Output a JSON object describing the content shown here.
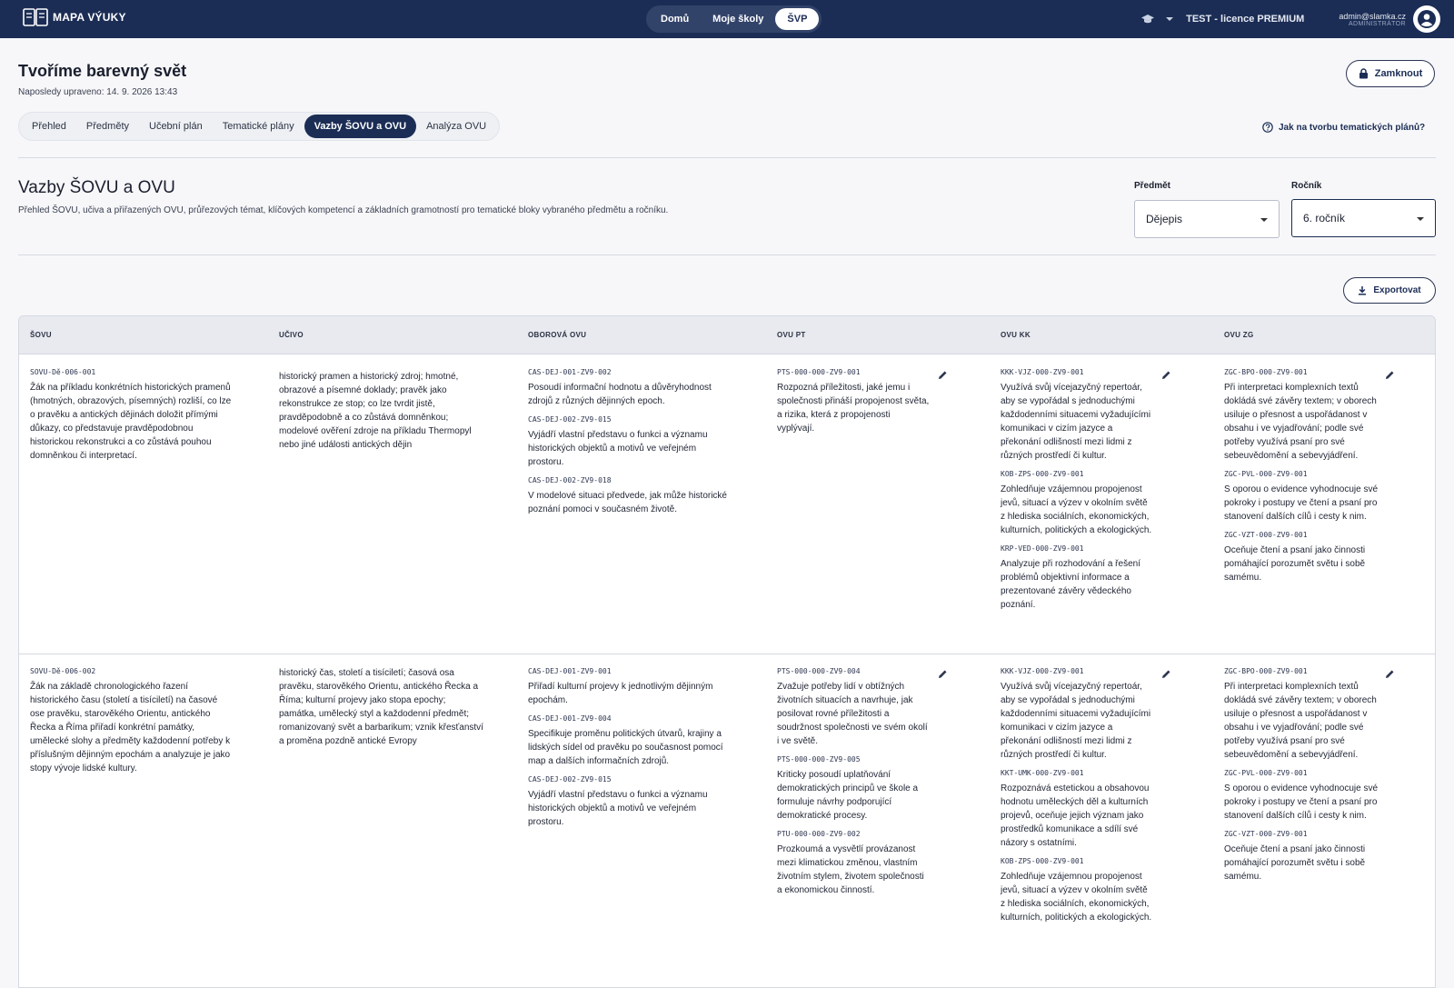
{
  "app": {
    "brand": "MAPA VÝUKY",
    "nav": [
      "Domů",
      "Moje školy",
      "ŠVP"
    ],
    "nav_active": 2,
    "license": "TEST - licence PREMIUM",
    "user_email": "admin@slamka.cz",
    "user_role": "ADMINISTRÁTOR",
    "accent_color": "#1b2d55"
  },
  "header": {
    "title": "Tvoříme barevný svět",
    "last_edited": "Naposledy upraveno: 14. 9. 2026 13:43",
    "lock_label": "Zamknout",
    "tabs": [
      "Přehled",
      "Předměty",
      "Učební plán",
      "Tematické plány",
      "Vazby ŠOVU a OVU",
      "Analýza OVU"
    ],
    "active_tab": 4,
    "help_link": "Jak na tvorbu tematických plánů?"
  },
  "section": {
    "title": "Vazby ŠOVU a OVU",
    "description": "Přehled ŠOVU, učiva a přiřazených OVU, průřezových témat, klíčových kompetencí a základních gramotností pro tematické bloky vybraného předmětu a ročníku.",
    "subject_label": "Předmět",
    "subject_value": "Dějepis",
    "grade_label": "Ročník",
    "grade_value": "6. ročník",
    "export_label": "Exportovat"
  },
  "table": {
    "headers": [
      "ŠOVU",
      "UČIVO",
      "OBOROVÁ OVU",
      "OVU PT",
      "OVU KK",
      "OVU ZG"
    ],
    "rows": [
      {
        "sovu_code": "SOVU-Dě-006-001",
        "sovu_text": "Žák na příkladu konkrétních historických pramenů (hmotných, obrazových, písemných) rozliší, co lze o pravěku a antických dějinách doložit přímými důkazy, co představuje pravděpodobnou historickou rekonstrukci a co zůstává pouhou domněnkou či interpretací.",
        "ucivo": "historický pramen a historický zdroj; hmotné, obrazové a písemné doklady; pravěk jako rekonstrukce ze stop; co lze tvrdit jistě, pravděpodobně a co zůstává domněnkou; modelové ověření zdroje na příkladu Thermopyl nebo jiné události antických dějin",
        "oborova": [
          {
            "code": "CAS-DEJ-001-ZV9-002",
            "text": "Posoudí informační hodnotu a důvěryhodnost zdrojů z různých dějinných epoch."
          },
          {
            "code": "CAS-DEJ-002-ZV9-015",
            "text": "Vyjádří vlastní představu o funkci a významu historických objektů a motivů ve veřejném prostoru."
          },
          {
            "code": "CAS-DEJ-002-ZV9-018",
            "text": "V modelové situaci předvede, jak může historické poznání pomoci v současném životě."
          }
        ],
        "pt": [
          {
            "code": "PTS-000-000-ZV9-001",
            "text": "Rozpozná příležitosti, jaké jemu i společnosti přináší propojenost světa, a rizika, která z propojenosti vyplývají."
          }
        ],
        "kk": [
          {
            "code": "KKK-VJZ-000-ZV9-001",
            "text": "Využívá svůj vícejazyčný repertoár, aby se vypořádal s jednoduchými každodenními situacemi vyžadujícími komunikaci v cizím jazyce a překonání odlišností mezi lidmi z různých prostředí či kultur."
          },
          {
            "code": "KOB-ZPS-000-ZV9-001",
            "text": "Zohledňuje vzájemnou propojenost jevů, situací a výzev v okolním světě z hlediska sociálních, ekonomických, kulturních, politických a ekologických."
          },
          {
            "code": "KRP-VED-000-ZV9-001",
            "text": "Analyzuje při rozhodování a řešení problémů objektivní informace a prezentované závěry vědeckého poznání."
          }
        ],
        "zg": [
          {
            "code": "ZGC-BPO-000-ZV9-001",
            "text": "Při interpretaci komplexních textů dokládá své závěry textem; v oborech usiluje o přesnost a uspořádanost v obsahu i ve vyjadřování; podle své potřeby využívá psaní pro své sebeuvědomění a sebevyjádření."
          },
          {
            "code": "ZGC-PVL-000-ZV9-001",
            "text": "S oporou o evidence vyhodnocuje své pokroky i postupy ve čtení a psaní pro stanovení dalších cílů i cesty k nim."
          },
          {
            "code": "ZGC-VZT-000-ZV9-001",
            "text": "Oceňuje čtení a psaní jako činnosti pomáhající porozumět světu i sobě samému."
          }
        ]
      },
      {
        "sovu_code": "SOVU-Dě-006-002",
        "sovu_text": "Žák na základě chronologického řazení historického času (století a tisíciletí) na časové ose pravěku, starověkého Orientu, antického Řecka a Říma přiřadí konkrétní památky, umělecké slohy a předměty každodenní potřeby k příslušným dějinným epochám a analyzuje je jako stopy vývoje lidské kultury.",
        "ucivo": "historický čas, století a tisíciletí; časová osa pravěku, starověkého Orientu, antického Řecka a Říma; kulturní projevy jako stopa epochy; památka, umělecký styl a každodenní předmět; romanizovaný svět a barbarikum; vznik křesťanství a proměna pozdně antické Evropy",
        "oborova": [
          {
            "code": "CAS-DEJ-001-ZV9-001",
            "text": "Přiřadí kulturní projevy k jednotlivým dějinným epochám."
          },
          {
            "code": "CAS-DEJ-001-ZV9-004",
            "text": "Specifikuje proměnu politických útvarů, krajiny a lidských sídel od pravěku po současnost pomocí map a dalších informačních zdrojů."
          },
          {
            "code": "CAS-DEJ-002-ZV9-015",
            "text": "Vyjádří vlastní představu o funkci a významu historických objektů a motivů ve veřejném prostoru."
          }
        ],
        "pt": [
          {
            "code": "PTS-000-000-ZV9-004",
            "text": "Zvažuje potřeby lidí v obtížných životních situacích a navrhuje, jak posilovat rovné příležitosti a soudržnost společnosti ve svém okolí i ve světě."
          },
          {
            "code": "PTS-000-000-ZV9-005",
            "text": "Kriticky posoudí uplatňování demokratických principů ve škole a formuluje návrhy podporující demokratické procesy."
          },
          {
            "code": "PTU-000-000-ZV9-002",
            "text": "Prozkoumá a vysvětlí provázanost mezi klimatickou změnou, vlastním životním stylem, životem společnosti a ekonomickou činností."
          }
        ],
        "kk": [
          {
            "code": "KKK-VJZ-000-ZV9-001",
            "text": "Využívá svůj vícejazyčný repertoár, aby se vypořádal s jednoduchými každodenními situacemi vyžadujícími komunikaci v cizím jazyce a překonání odlišností mezi lidmi z různých prostředí či kultur."
          },
          {
            "code": "KKT-UMK-000-ZV9-001",
            "text": "Rozpoznává estetickou a obsahovou hodnotu uměleckých děl a kulturních projevů, oceňuje jejich význam jako prostředků komunikace a sdílí své názory s ostatními."
          },
          {
            "code": "KOB-ZPS-000-ZV9-001",
            "text": "Zohledňuje vzájemnou propojenost jevů, situací a výzev v okolním světě z hlediska sociálních, ekonomických, kulturních, politických a ekologických."
          }
        ],
        "zg": [
          {
            "code": "ZGC-BPO-000-ZV9-001",
            "text": "Při interpretaci komplexních textů dokládá své závěry textem; v oborech usiluje o přesnost a uspořádanost v obsahu i ve vyjadřování; podle své potřeby využívá psaní pro své sebeuvědomění a sebevyjádření."
          },
          {
            "code": "ZGC-PVL-000-ZV9-001",
            "text": "S oporou o evidence vyhodnocuje své pokroky i postupy ve čtení a psaní pro stanovení dalších cílů i cesty k nim."
          },
          {
            "code": "ZGC-VZT-000-ZV9-001",
            "text": "Oceňuje čtení a psaní jako činnosti pomáhající porozumět světu i sobě samému."
          }
        ]
      }
    ]
  }
}
